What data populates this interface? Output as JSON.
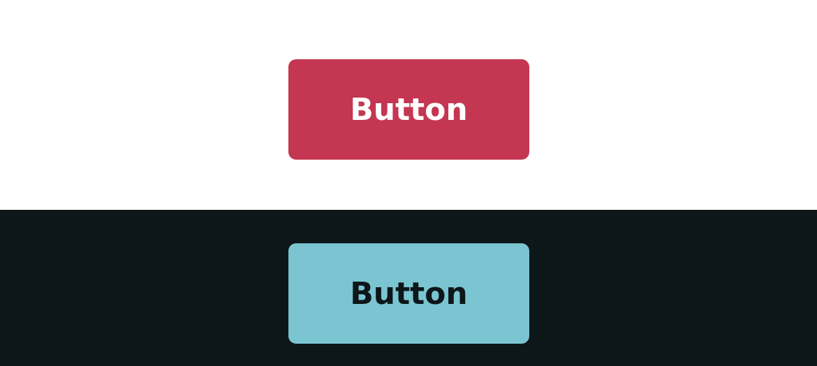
{
  "theme_light": {
    "background": "#ffffff",
    "button": {
      "label": "Button",
      "background": "#c43651",
      "text_color": "#ffffff"
    }
  },
  "theme_dark": {
    "background": "#0d1619",
    "button": {
      "label": "Button",
      "background": "#7ac5d1",
      "text_color": "#0d1619"
    }
  }
}
